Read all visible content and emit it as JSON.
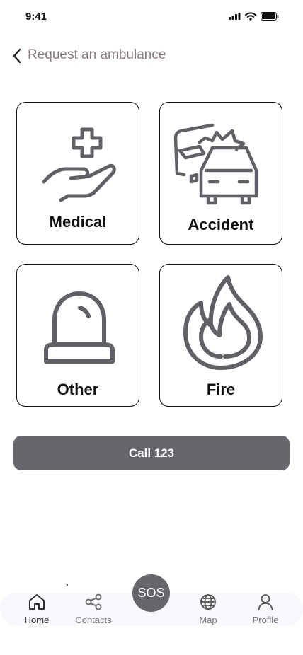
{
  "status_bar": {
    "time": "9:41",
    "icons": [
      "signal-icon",
      "wifi-icon",
      "battery-icon"
    ]
  },
  "header": {
    "title": "Request an ambulance",
    "back_icon": "chevron-left-icon"
  },
  "cards": [
    {
      "label": "Medical",
      "icon": "medical-hand-icon"
    },
    {
      "label": "Accident",
      "icon": "car-accident-icon"
    },
    {
      "label": "Other",
      "icon": "siren-icon"
    },
    {
      "label": "Fire",
      "icon": "flame-icon"
    }
  ],
  "call_button": {
    "label": "Call 123"
  },
  "bottom_nav": {
    "items": [
      {
        "label": "Home",
        "icon": "home-icon",
        "active": true
      },
      {
        "label": "Contacts",
        "icon": "share-icon"
      },
      {
        "label": "Map",
        "icon": "globe-icon"
      },
      {
        "label": "Profile",
        "icon": "user-icon"
      }
    ],
    "sos_label": "SOS"
  },
  "colors": {
    "primary": "#65666b",
    "title_text": "#8c7a7d",
    "nav_background": "#f6f8fc",
    "icon_stroke": "#5f6166"
  }
}
